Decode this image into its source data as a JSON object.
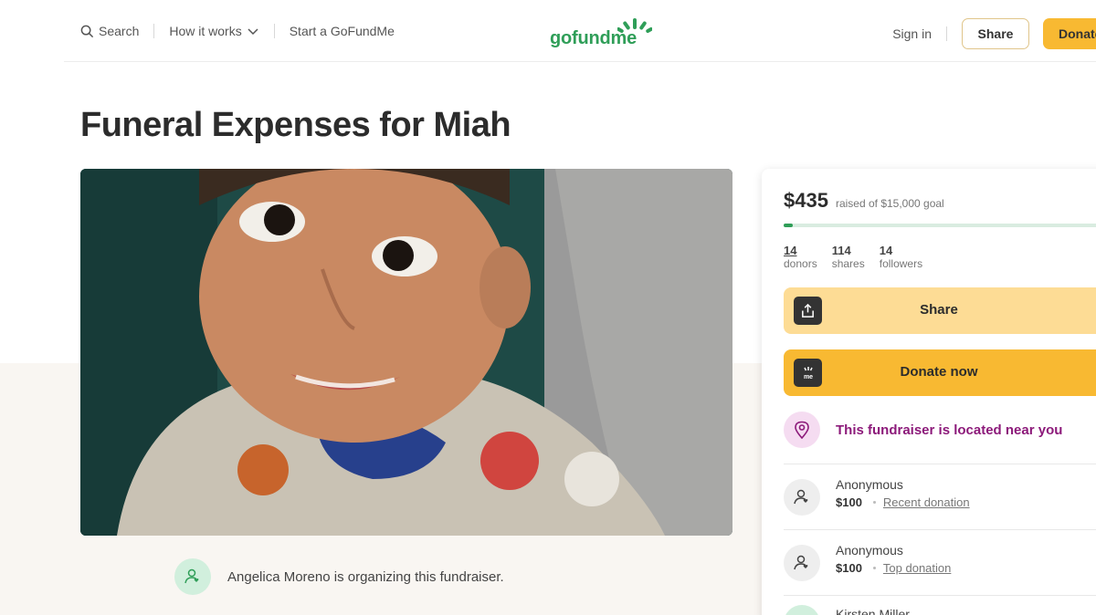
{
  "header": {
    "search_label": "Search",
    "how_it_works_label": "How it works",
    "start_label": "Start a GoFundMe",
    "logo_text": "gofundme",
    "sign_in_label": "Sign in",
    "share_label": "Share",
    "donate_label": "Donate"
  },
  "campaign": {
    "title": "Funeral Expenses for Miah",
    "photo_alt": "campaign photo"
  },
  "organizer": {
    "text": "Angelica Moreno is organizing this fundraiser."
  },
  "card": {
    "amount": "$435",
    "goal_text": "raised of $15,000 goal",
    "progress_fraction": 0.029,
    "stats": {
      "donors_num": "14",
      "donors_label": "donors",
      "shares_num": "114",
      "shares_label": "shares",
      "followers_num": "14",
      "followers_label": "followers"
    },
    "share_label": "Share",
    "donate_label": "Donate now",
    "nearby_text": "This fundraiser is located near you",
    "donations": [
      {
        "name": "Anonymous",
        "amount": "$100",
        "tag": "Recent donation"
      },
      {
        "name": "Anonymous",
        "amount": "$100",
        "tag": "Top donation"
      }
    ],
    "partial_name": "Kirsten Miller"
  },
  "colors": {
    "brand_green": "#2f9e58",
    "donate_yellow": "#f8b932",
    "share_yellow": "#fddc95",
    "nearby_purple": "#8c1a7a"
  }
}
